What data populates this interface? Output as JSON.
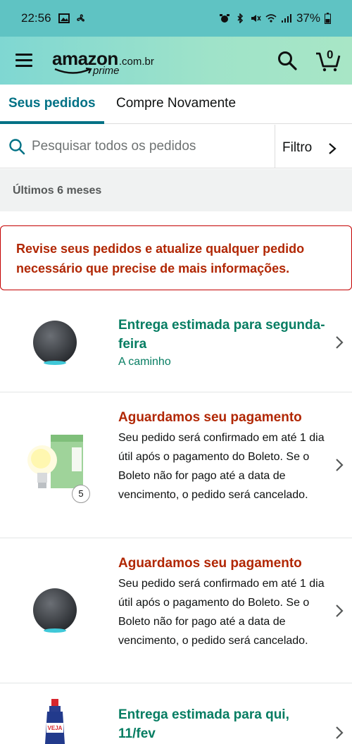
{
  "status_bar": {
    "time": "22:56",
    "battery": "37%",
    "left_icons": [
      "image-icon",
      "fan-icon"
    ],
    "right_icons": [
      "alarm-icon",
      "bluetooth-icon",
      "mute-icon",
      "wifi-icon",
      "signal-icon",
      "battery-icon"
    ]
  },
  "header": {
    "logo_word": "amazon",
    "logo_domain": ".com.br",
    "logo_prime": "prime",
    "cart_count": "0",
    "colors": {
      "gradient_start": "#7fd7d2",
      "gradient_end": "#a8e6c6"
    }
  },
  "tabs": {
    "active": "Seus pedidos",
    "other": "Compre Novamente"
  },
  "search": {
    "placeholder": "Pesquisar todos os pedidos",
    "filter_label": "Filtro"
  },
  "period_label": "Últimos 6 meses",
  "alert_text": "Revise seus pedidos e atualize qualquer pedido necessário que precise de mais informações.",
  "orders": [
    {
      "status": "Entrega estimada para segunda-feira",
      "substatus": "A caminho",
      "image": "smart-speaker-image"
    },
    {
      "status": "Aguardamos seu pagamento",
      "description": "Seu pedido será confirmado em até 1 dia útil após o pagamento do Boleto. Se o Boleto não for pago até a data de vencimento, o pedido será cancelado.",
      "image": "smart-bulb-image",
      "quantity_badge": "5"
    },
    {
      "status": "Aguardamos seu pagamento",
      "description": "Seu pedido será confirmado em até 1 dia útil após o pagamento do Boleto. Se o Boleto não for pago até a data de vencimento, o pedido será cancelado.",
      "image": "smart-speaker-image"
    },
    {
      "status": "Entrega estimada para qui, 11/fev",
      "image": "cleaner-bottle-image"
    }
  ],
  "colors": {
    "teal_link": "#007185",
    "green_status": "#067d62",
    "red_status": "#b12704",
    "alert_border": "#c40000"
  }
}
